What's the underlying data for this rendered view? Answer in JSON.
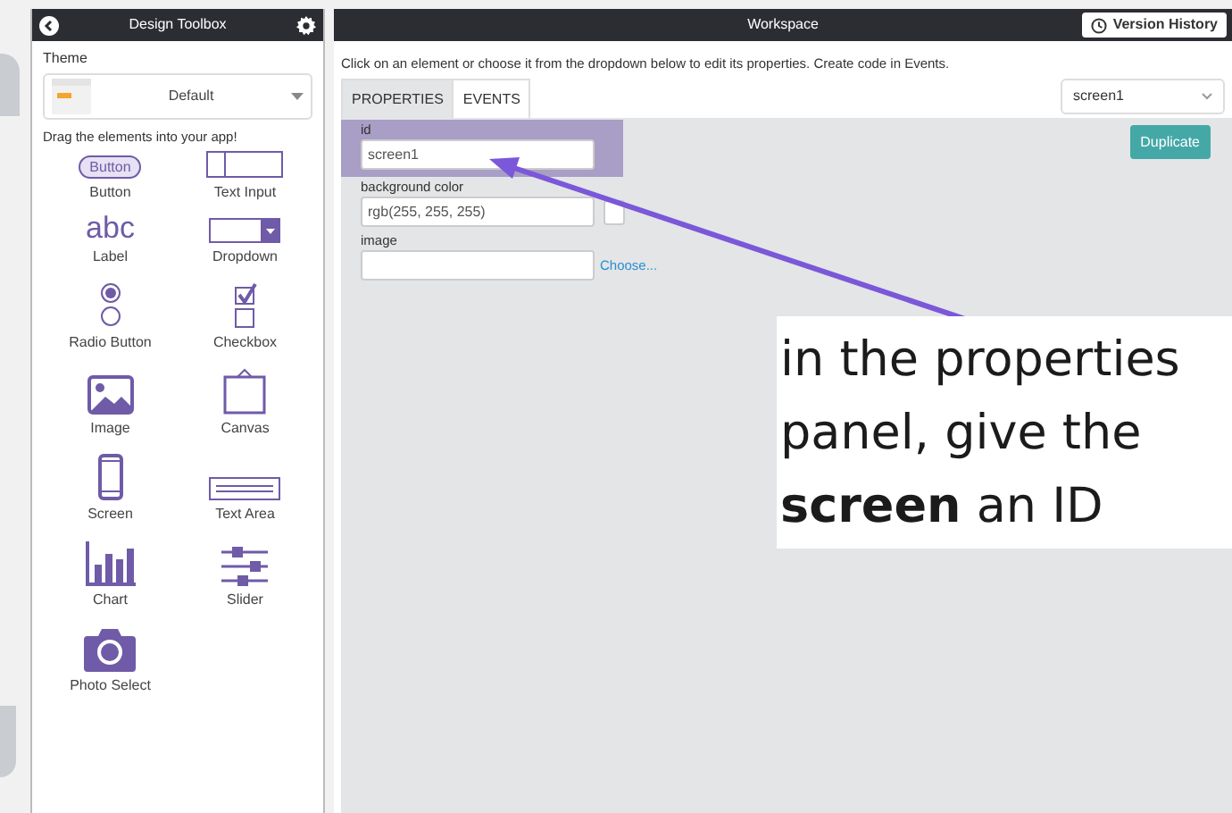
{
  "toolbox": {
    "title": "Design Toolbox",
    "theme_label": "Theme",
    "theme_value": "Default",
    "hint": "Drag the elements into your app!",
    "items": [
      {
        "kind": "button",
        "label": "Button",
        "icon_text": "Button"
      },
      {
        "kind": "text_input",
        "label": "Text Input"
      },
      {
        "kind": "label",
        "label": "Label",
        "icon_text": "abc"
      },
      {
        "kind": "dropdown",
        "label": "Dropdown"
      },
      {
        "kind": "radio",
        "label": "Radio Button"
      },
      {
        "kind": "checkbox",
        "label": "Checkbox"
      },
      {
        "kind": "image",
        "label": "Image"
      },
      {
        "kind": "canvas",
        "label": "Canvas"
      },
      {
        "kind": "screen",
        "label": "Screen"
      },
      {
        "kind": "text_area",
        "label": "Text Area"
      },
      {
        "kind": "chart",
        "label": "Chart"
      },
      {
        "kind": "slider",
        "label": "Slider"
      },
      {
        "kind": "photo",
        "label": "Photo Select"
      }
    ]
  },
  "workspace": {
    "title": "Workspace",
    "version_button": "Version History",
    "instructions": "Click on an element or choose it from the dropdown below to edit its properties. Create code in Events.",
    "tabs": [
      {
        "label": "PROPERTIES",
        "selected": true
      },
      {
        "label": "EVENTS",
        "selected": false
      }
    ],
    "element_select": "screen1",
    "duplicate_button": "Duplicate",
    "fields": [
      {
        "label": "id",
        "value": "screen1",
        "highlighted": true
      },
      {
        "label": "background color",
        "value": "rgb(255, 255, 255)",
        "highlighted": false,
        "swatch": true
      },
      {
        "label": "image",
        "highlighted": false,
        "link": "Choose..."
      }
    ]
  },
  "annotation": {
    "text": "in the properties panel, give the **screen** an ID"
  }
}
